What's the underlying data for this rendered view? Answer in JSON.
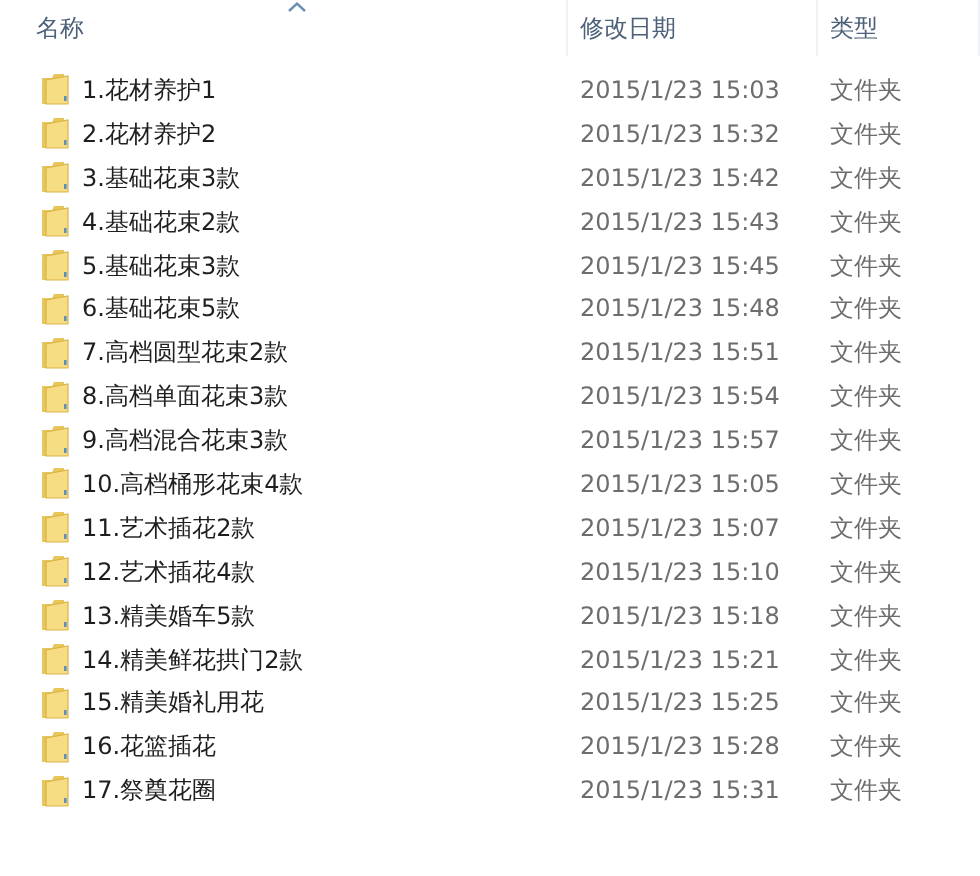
{
  "columns": [
    {
      "label": "名称",
      "sorted": true
    },
    {
      "label": "修改日期",
      "sorted": false
    },
    {
      "label": "类型",
      "sorted": false
    }
  ],
  "rows": [
    {
      "name": "1.花材养护1",
      "modified": "2015/1/23 15:03",
      "type": "文件夹"
    },
    {
      "name": "2.花材养护2",
      "modified": "2015/1/23 15:32",
      "type": "文件夹"
    },
    {
      "name": "3.基础花束3款",
      "modified": "2015/1/23 15:42",
      "type": "文件夹"
    },
    {
      "name": "4.基础花束2款",
      "modified": "2015/1/23 15:43",
      "type": "文件夹"
    },
    {
      "name": "5.基础花束3款",
      "modified": "2015/1/23 15:45",
      "type": "文件夹"
    },
    {
      "name": "6.基础花束5款",
      "modified": "2015/1/23 15:48",
      "type": "文件夹"
    },
    {
      "name": "7.高档圆型花束2款",
      "modified": "2015/1/23 15:51",
      "type": "文件夹"
    },
    {
      "name": "8.高档单面花束3款",
      "modified": "2015/1/23 15:54",
      "type": "文件夹"
    },
    {
      "name": "9.高档混合花束3款",
      "modified": "2015/1/23 15:57",
      "type": "文件夹"
    },
    {
      "name": "10.高档桶形花束4款",
      "modified": "2015/1/23 15:05",
      "type": "文件夹"
    },
    {
      "name": "11.艺术插花2款",
      "modified": "2015/1/23 15:07",
      "type": "文件夹"
    },
    {
      "name": "12.艺术插花4款",
      "modified": "2015/1/23 15:10",
      "type": "文件夹"
    },
    {
      "name": "13.精美婚车5款",
      "modified": "2015/1/23 15:18",
      "type": "文件夹"
    },
    {
      "name": "14.精美鲜花拱门2款",
      "modified": "2015/1/23 15:21",
      "type": "文件夹"
    },
    {
      "name": "15.精美婚礼用花",
      "modified": "2015/1/23 15:25",
      "type": "文件夹"
    },
    {
      "name": "16.花篮插花",
      "modified": "2015/1/23 15:28",
      "type": "文件夹"
    },
    {
      "name": "17.祭奠花圈",
      "modified": "2015/1/23 15:31",
      "type": "文件夹"
    }
  ]
}
